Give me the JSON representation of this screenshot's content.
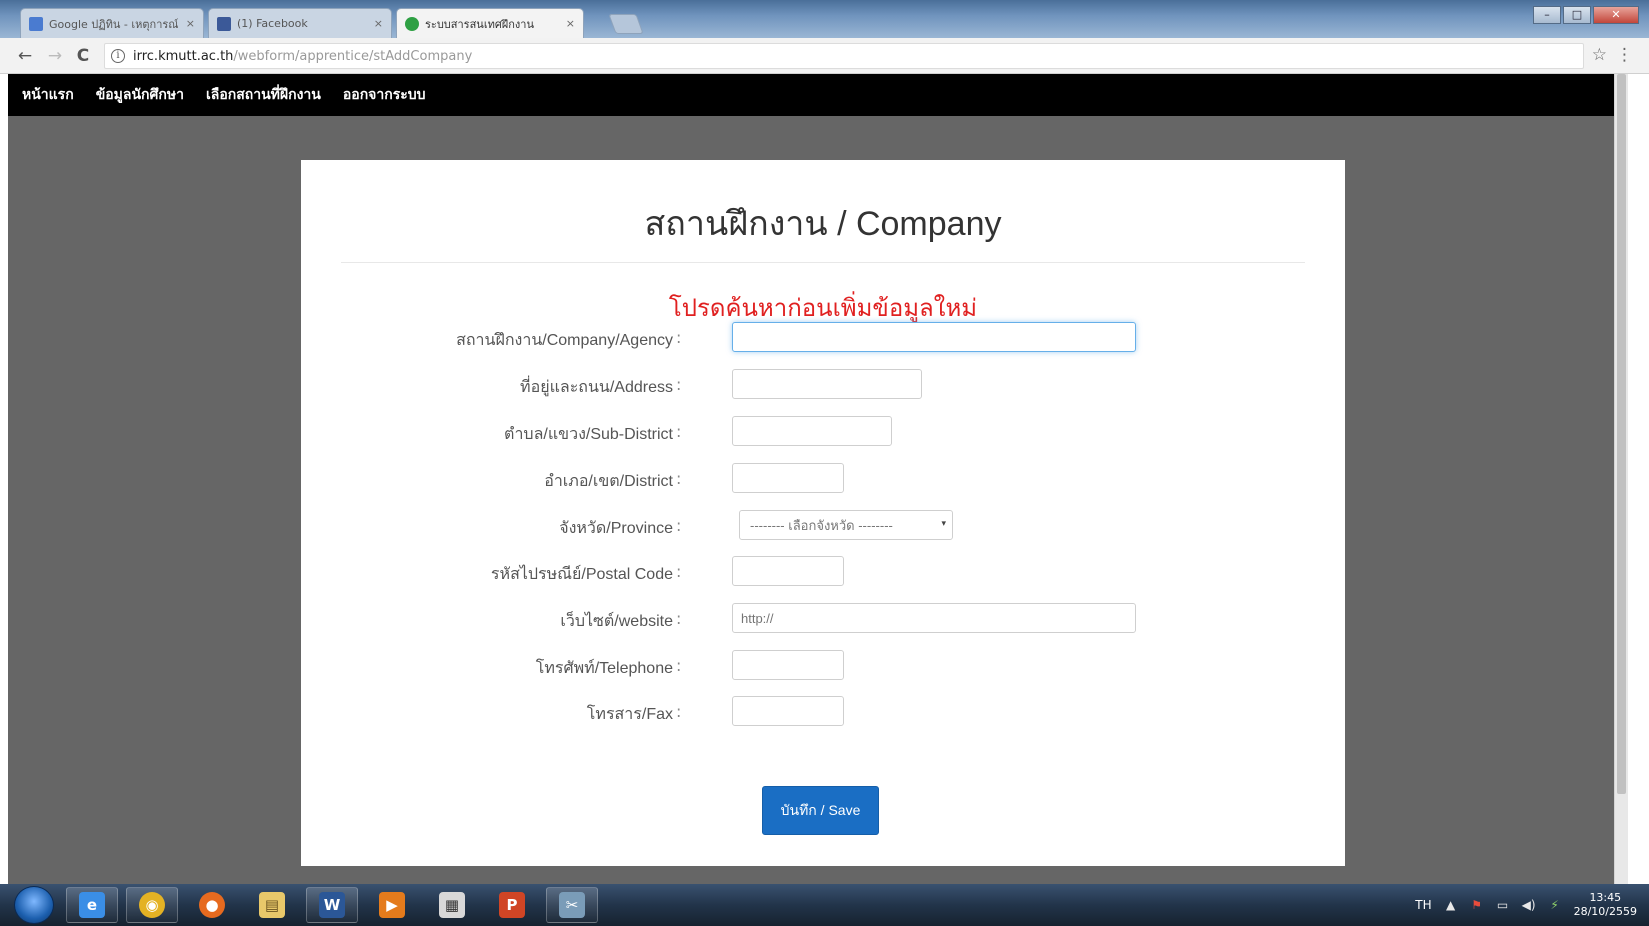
{
  "browser": {
    "tabs": [
      {
        "label": "Google ปฏิทิน - เหตุการณ์",
        "favicon_color": "#4a7bd0"
      },
      {
        "label": "(1) Facebook",
        "favicon_color": "#3b5998"
      },
      {
        "label": "ระบบสารสนเทศฝึกงาน",
        "favicon_color": "#2ea043"
      }
    ],
    "url_host": "irrc.kmutt.ac.th",
    "url_path": "/webform/apprentice/stAddCompany",
    "nav_back": "←",
    "nav_forward": "→",
    "nav_reload": "C",
    "info_glyph": "i",
    "star_glyph": "☆",
    "menu_glyph": "⋮",
    "tab_close_glyph": "×",
    "win_min": "–",
    "win_max": "□",
    "win_close": "✕"
  },
  "site_nav": {
    "items": [
      "หน้าแรก",
      "ข้อมูลนักศึกษา",
      "เลือกสถานที่ฝึกงาน",
      "ออกจากระบบ"
    ]
  },
  "form": {
    "title": "สถานฝึกงาน / Company",
    "warning": "โปรดค้นหาก่อนเพิ่มข้อมูลใหม่",
    "fields": [
      {
        "label": "สถานฝึกงาน/Company/Agency",
        "colon": ":",
        "value": "",
        "placeholder": ""
      },
      {
        "label": "ที่อยู่และถนน/Address",
        "colon": ":",
        "value": "",
        "placeholder": ""
      },
      {
        "label": "ตำบล/แขวง/Sub-District",
        "colon": ":",
        "value": "",
        "placeholder": ""
      },
      {
        "label": "อำเภอ/เขต/District",
        "colon": ":",
        "value": "",
        "placeholder": ""
      },
      {
        "label": "จังหวัด/Province",
        "colon": ":",
        "selected": "-------- เลือกจังหวัด --------"
      },
      {
        "label": "รหัสไปรษณีย์/Postal Code",
        "colon": ":",
        "value": "",
        "placeholder": ""
      },
      {
        "label": "เว็บไซต์/website",
        "colon": ":",
        "value": "",
        "placeholder": "http://"
      },
      {
        "label": "โทรศัพท์/Telephone",
        "colon": ":",
        "value": "",
        "placeholder": ""
      },
      {
        "label": "โทรสาร/Fax",
        "colon": ":",
        "value": "",
        "placeholder": ""
      }
    ],
    "save_label": "บันทึก / Save",
    "caret_glyph": "▾"
  },
  "taskbar": {
    "apps": [
      {
        "name": "internet-explorer",
        "glyph": "e",
        "color": "#3a8ee6"
      },
      {
        "name": "chrome",
        "glyph": "◉",
        "color": "#e4b224"
      },
      {
        "name": "firefox",
        "glyph": "●",
        "color": "#e66a1f"
      },
      {
        "name": "file-explorer",
        "glyph": "▤",
        "color": "#e8c86a"
      },
      {
        "name": "word",
        "glyph": "W",
        "color": "#2b5797"
      },
      {
        "name": "media-player",
        "glyph": "▶",
        "color": "#e47b1c"
      },
      {
        "name": "calculator",
        "glyph": "▦",
        "color": "#d8d8d8"
      },
      {
        "name": "powerpoint",
        "glyph": "P",
        "color": "#d04525"
      },
      {
        "name": "snipping-tool",
        "glyph": "✂",
        "color": "#7a9cb8"
      }
    ],
    "tray": {
      "language": "TH",
      "arrow": "▲",
      "flag_glyph": "⚑",
      "network_glyph": "▭",
      "volume_glyph": "◀)",
      "power_glyph": "⚡",
      "time": "13:45",
      "date": "28/10/2559"
    }
  }
}
